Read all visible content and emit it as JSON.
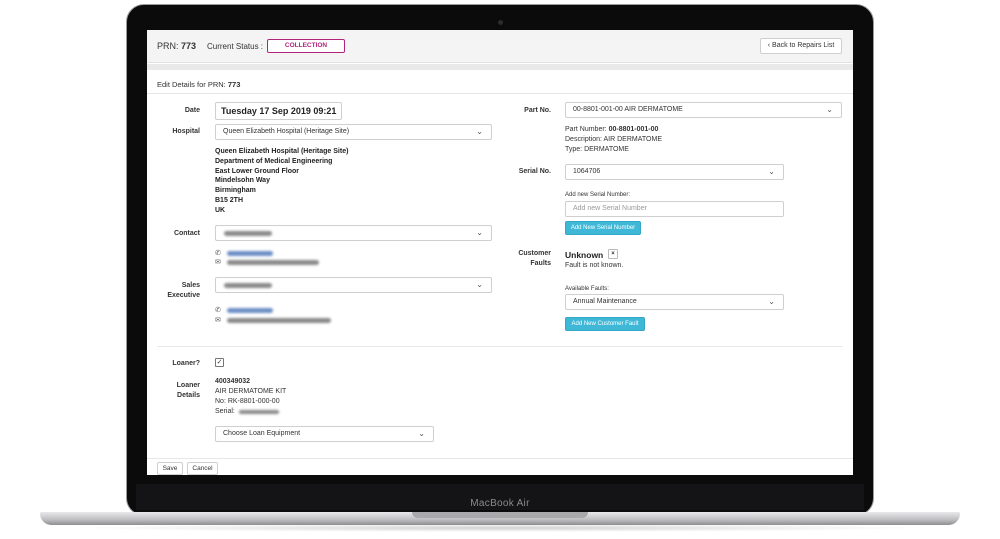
{
  "device": {
    "brand": "MacBook Air"
  },
  "header": {
    "prn_label": "PRN:",
    "prn_value": "773",
    "status_label": "Current Status :",
    "status_value": "COLLECTION",
    "back_button": "Back to Repairs List"
  },
  "form": {
    "title_prefix": "Edit Details for PRN:",
    "title_prn": "773",
    "date": {
      "label": "Date",
      "value": "Tuesday 17 Sep 2019 09:21"
    },
    "hospital": {
      "label": "Hospital",
      "selected": "Queen Elizabeth Hospital (Heritage Site)",
      "address": [
        "Queen Elizabeth Hospital (Heritage Site)",
        "Department of Medical Engineering",
        "East Lower Ground Floor",
        "Mindelsohn Way",
        "Birmingham",
        "B15 2TH",
        "UK"
      ]
    },
    "contact": {
      "label": "Contact"
    },
    "sales_executive": {
      "label_line1": "Sales",
      "label_line2": "Executive"
    },
    "part": {
      "label": "Part No.",
      "selected": "00-8801-001-00 AIR DERMATOME",
      "number_label": "Part Number:",
      "number_value": "00-8801-001-00",
      "description": "Description: AIR DERMATOME",
      "type": "Type: DERMATOME"
    },
    "serial": {
      "label": "Serial No.",
      "selected": "1064706",
      "add_label": "Add new Serial Number:",
      "add_placeholder": "Add new Serial Number",
      "add_button": "Add New Serial Number"
    },
    "faults": {
      "label_line1": "Customer",
      "label_line2": "Faults",
      "current": "Unknown",
      "remove_glyph": "×",
      "note": "Fault is not known.",
      "available_label": "Available Faults:",
      "available_selected": "Annual Maintenance",
      "add_button": "Add New Customer Fault"
    },
    "loaner": {
      "label": "Loaner?",
      "checked_glyph": "✓",
      "details_label_line1": "Loaner",
      "details_label_line2": "Details",
      "code": "400349032",
      "name": "AIR DERMATOME KIT",
      "number": "No: RK-8801-000-00",
      "serial_label": "Serial:",
      "choose_placeholder": "Choose Loan Equipment"
    },
    "save_button": "Save",
    "cancel_button": "Cancel"
  },
  "icons": {
    "caret": "⌄",
    "phone": "✆",
    "mail": "✉",
    "back_chevron": "‹"
  }
}
